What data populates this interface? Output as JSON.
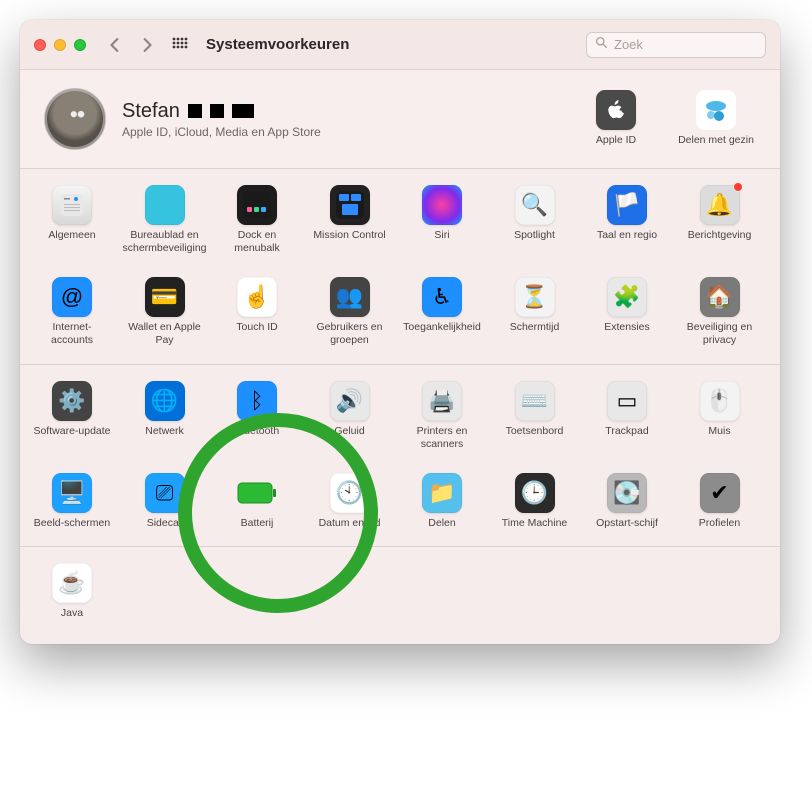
{
  "window": {
    "title": "Systeemvoorkeuren",
    "search_placeholder": "Zoek"
  },
  "profile": {
    "name": "Stefan",
    "subtitle": "Apple ID, iCloud, Media en App Store"
  },
  "profile_items": [
    {
      "id": "apple-id",
      "label": "Apple ID",
      "bg": "#4a4a4a",
      "glyph": ""
    },
    {
      "id": "family-sharing",
      "label": "Delen met gezin",
      "bg": "#ffffff",
      "glyph": "👥"
    }
  ],
  "sections": [
    {
      "items": [
        {
          "id": "general",
          "label": "Algemeen",
          "bg": "linear-gradient(#f5f5f5,#d8d8d8)",
          "glyph": ""
        },
        {
          "id": "desktop",
          "label": "Bureaublad en schermbeveiliging",
          "bg": "#35c3e0",
          "glyph": ""
        },
        {
          "id": "dock",
          "label": "Dock en menubalk",
          "bg": "#1d1d1d",
          "glyph": ""
        },
        {
          "id": "mission-control",
          "label": "Mission Control",
          "bg": "#222",
          "glyph": ""
        },
        {
          "id": "siri",
          "label": "Siri",
          "bg": "radial-gradient(circle,#ff3ea0,#7e2bec 60%,#0fa5ff)",
          "glyph": ""
        },
        {
          "id": "spotlight",
          "label": "Spotlight",
          "bg": "#f3f3f3",
          "glyph": "🔍"
        },
        {
          "id": "language-region",
          "label": "Taal en regio",
          "bg": "#1e6fe8",
          "glyph": "🏳️"
        },
        {
          "id": "notifications",
          "label": "Berichtgeving",
          "bg": "#dcdcdc",
          "glyph": "🔔",
          "badge": true
        },
        {
          "id": "internet-accounts",
          "label": "Internet-accounts",
          "bg": "#1e8fff",
          "glyph": "@"
        },
        {
          "id": "wallet",
          "label": "Wallet en Apple Pay",
          "bg": "#222",
          "glyph": "💳"
        },
        {
          "id": "touch-id",
          "label": "Touch ID",
          "bg": "#ffffff",
          "glyph": "☝️"
        },
        {
          "id": "users-groups",
          "label": "Gebruikers en groepen",
          "bg": "#444",
          "glyph": "👥"
        },
        {
          "id": "accessibility",
          "label": "Toegankelijkheid",
          "bg": "#1e8fff",
          "glyph": "♿︎"
        },
        {
          "id": "screen-time",
          "label": "Schermtijd",
          "bg": "#f3f3f3",
          "glyph": "⏳"
        },
        {
          "id": "extensions",
          "label": "Extensies",
          "bg": "#e8e8e8",
          "glyph": "🧩"
        },
        {
          "id": "security-privacy",
          "label": "Beveiliging en privacy",
          "bg": "#7a7a7a",
          "glyph": "🏠"
        }
      ]
    },
    {
      "items": [
        {
          "id": "software-update",
          "label": "Software-update",
          "bg": "#444",
          "glyph": "⚙️"
        },
        {
          "id": "network",
          "label": "Netwerk",
          "bg": "#0070d8",
          "glyph": "🌐"
        },
        {
          "id": "bluetooth",
          "label": "Bluetooth",
          "bg": "#1e8fff",
          "glyph": "ᛒ"
        },
        {
          "id": "sound",
          "label": "Geluid",
          "bg": "#e8e8e8",
          "glyph": "🔊"
        },
        {
          "id": "printers-scanners",
          "label": "Printers en scanners",
          "bg": "#e8e8e8",
          "glyph": "🖨️"
        },
        {
          "id": "keyboard",
          "label": "Toetsenbord",
          "bg": "#e8e8e8",
          "glyph": "⌨️"
        },
        {
          "id": "trackpad",
          "label": "Trackpad",
          "bg": "#e8e8e8",
          "glyph": "▭"
        },
        {
          "id": "mouse",
          "label": "Muis",
          "bg": "#f3f3f3",
          "glyph": "🖱️"
        },
        {
          "id": "displays",
          "label": "Beeld-schermen",
          "bg": "#1ea0ff",
          "glyph": "🖥️"
        },
        {
          "id": "sidecar",
          "label": "Sidecar",
          "bg": "#1ea0ff",
          "glyph": "⎚"
        },
        {
          "id": "battery",
          "label": "Batterij",
          "bg": "transparent",
          "glyph": "🔋"
        },
        {
          "id": "date-time",
          "label": "Datum en tijd",
          "bg": "#ffffff",
          "glyph": "🕙"
        },
        {
          "id": "sharing",
          "label": "Delen",
          "bg": "#55c0ec",
          "glyph": "📁"
        },
        {
          "id": "time-machine",
          "label": "Time Machine",
          "bg": "#2b2b2b",
          "glyph": "🕒"
        },
        {
          "id": "startup-disk",
          "label": "Opstart-schijf",
          "bg": "#b8b8b8",
          "glyph": "💽"
        },
        {
          "id": "profiles",
          "label": "Profielen",
          "bg": "#8c8c8c",
          "glyph": "✔︎"
        }
      ]
    },
    {
      "items": [
        {
          "id": "java",
          "label": "Java",
          "bg": "#ffffff",
          "glyph": "☕"
        }
      ]
    }
  ],
  "highlight": {
    "section": 1,
    "target": "battery"
  }
}
